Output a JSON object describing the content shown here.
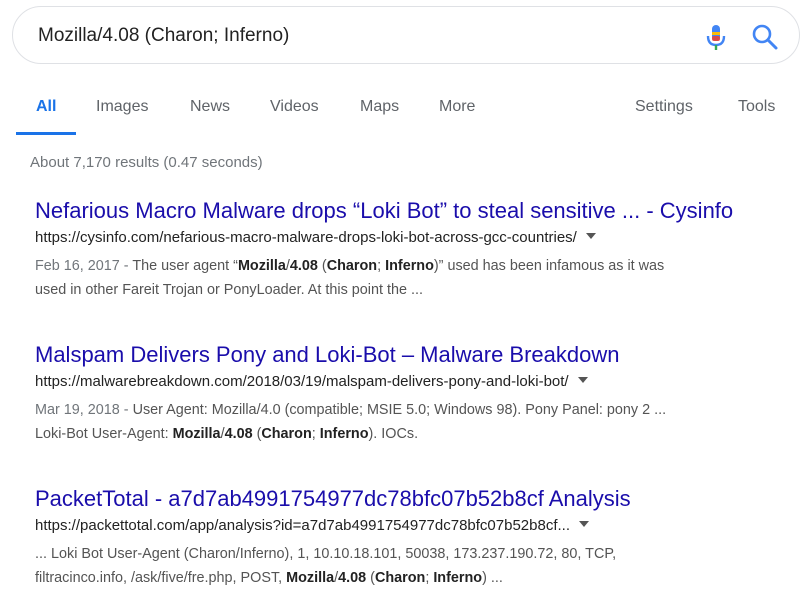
{
  "search": {
    "query": "Mozilla/4.08 (Charon; Inferno)"
  },
  "tabs": [
    {
      "label": "All"
    },
    {
      "label": "Images"
    },
    {
      "label": "News"
    },
    {
      "label": "Videos"
    },
    {
      "label": "Maps"
    },
    {
      "label": "More"
    },
    {
      "label": "Settings"
    },
    {
      "label": "Tools"
    }
  ],
  "stats": "About 7,170 results (0.47 seconds)",
  "results": [
    {
      "title": "Nefarious Macro Malware drops “Loki Bot” to steal sensitive ... - Cysinfo",
      "url": "https://cysinfo.com/nefarious-macro-malware-drops-loki-bot-across-gcc-countries/",
      "date": "Feb 16, 2017 - ",
      "snippet_l1_a": "The user agent “",
      "snippet_l1_b": "Mozilla",
      "snippet_l1_c": "/",
      "snippet_l1_d": "4.08",
      "snippet_l1_e": " (",
      "snippet_l1_f": "Charon",
      "snippet_l1_g": "; ",
      "snippet_l1_h": "Inferno",
      "snippet_l1_i": ")” used has been infamous as it was",
      "snippet_l2": "used in other Fareit Trojan or PonyLoader. At this point the ..."
    },
    {
      "title": "Malspam Delivers Pony and Loki-Bot – Malware Breakdown",
      "url": "https://malwarebreakdown.com/2018/03/19/malspam-delivers-pony-and-loki-bot/",
      "date": "Mar 19, 2018 - ",
      "snippet_l1": "User Agent: Mozilla/4.0 (compatible; MSIE 5.0; Windows 98). Pony Panel: pony 2 ...",
      "snippet_l2_a": "Loki-Bot User-Agent: ",
      "snippet_l2_b": "Mozilla",
      "snippet_l2_c": "/",
      "snippet_l2_d": "4.08",
      "snippet_l2_e": " (",
      "snippet_l2_f": "Charon",
      "snippet_l2_g": "; ",
      "snippet_l2_h": "Inferno",
      "snippet_l2_i": "). IOCs."
    },
    {
      "title": "PacketTotal - a7d7ab4991754977dc78bfc07b52b8cf Analysis",
      "url": "https://packettotal.com/app/analysis?id=a7d7ab4991754977dc78bfc07b52b8cf...",
      "snippet_l1": "... Loki Bot User-Agent (Charon/Inferno), 1, 10.10.18.101, 50038, 173.237.190.72, 80, TCP,",
      "snippet_l2_a": "filtracinco.info, /ask/five/fre.php, POST, ",
      "snippet_l2_b": "Mozilla",
      "snippet_l2_c": "/",
      "snippet_l2_d": "4.08",
      "snippet_l2_e": " (",
      "snippet_l2_f": "Charon",
      "snippet_l2_g": "; ",
      "snippet_l2_h": "Inferno",
      "snippet_l2_i": ") ..."
    }
  ]
}
